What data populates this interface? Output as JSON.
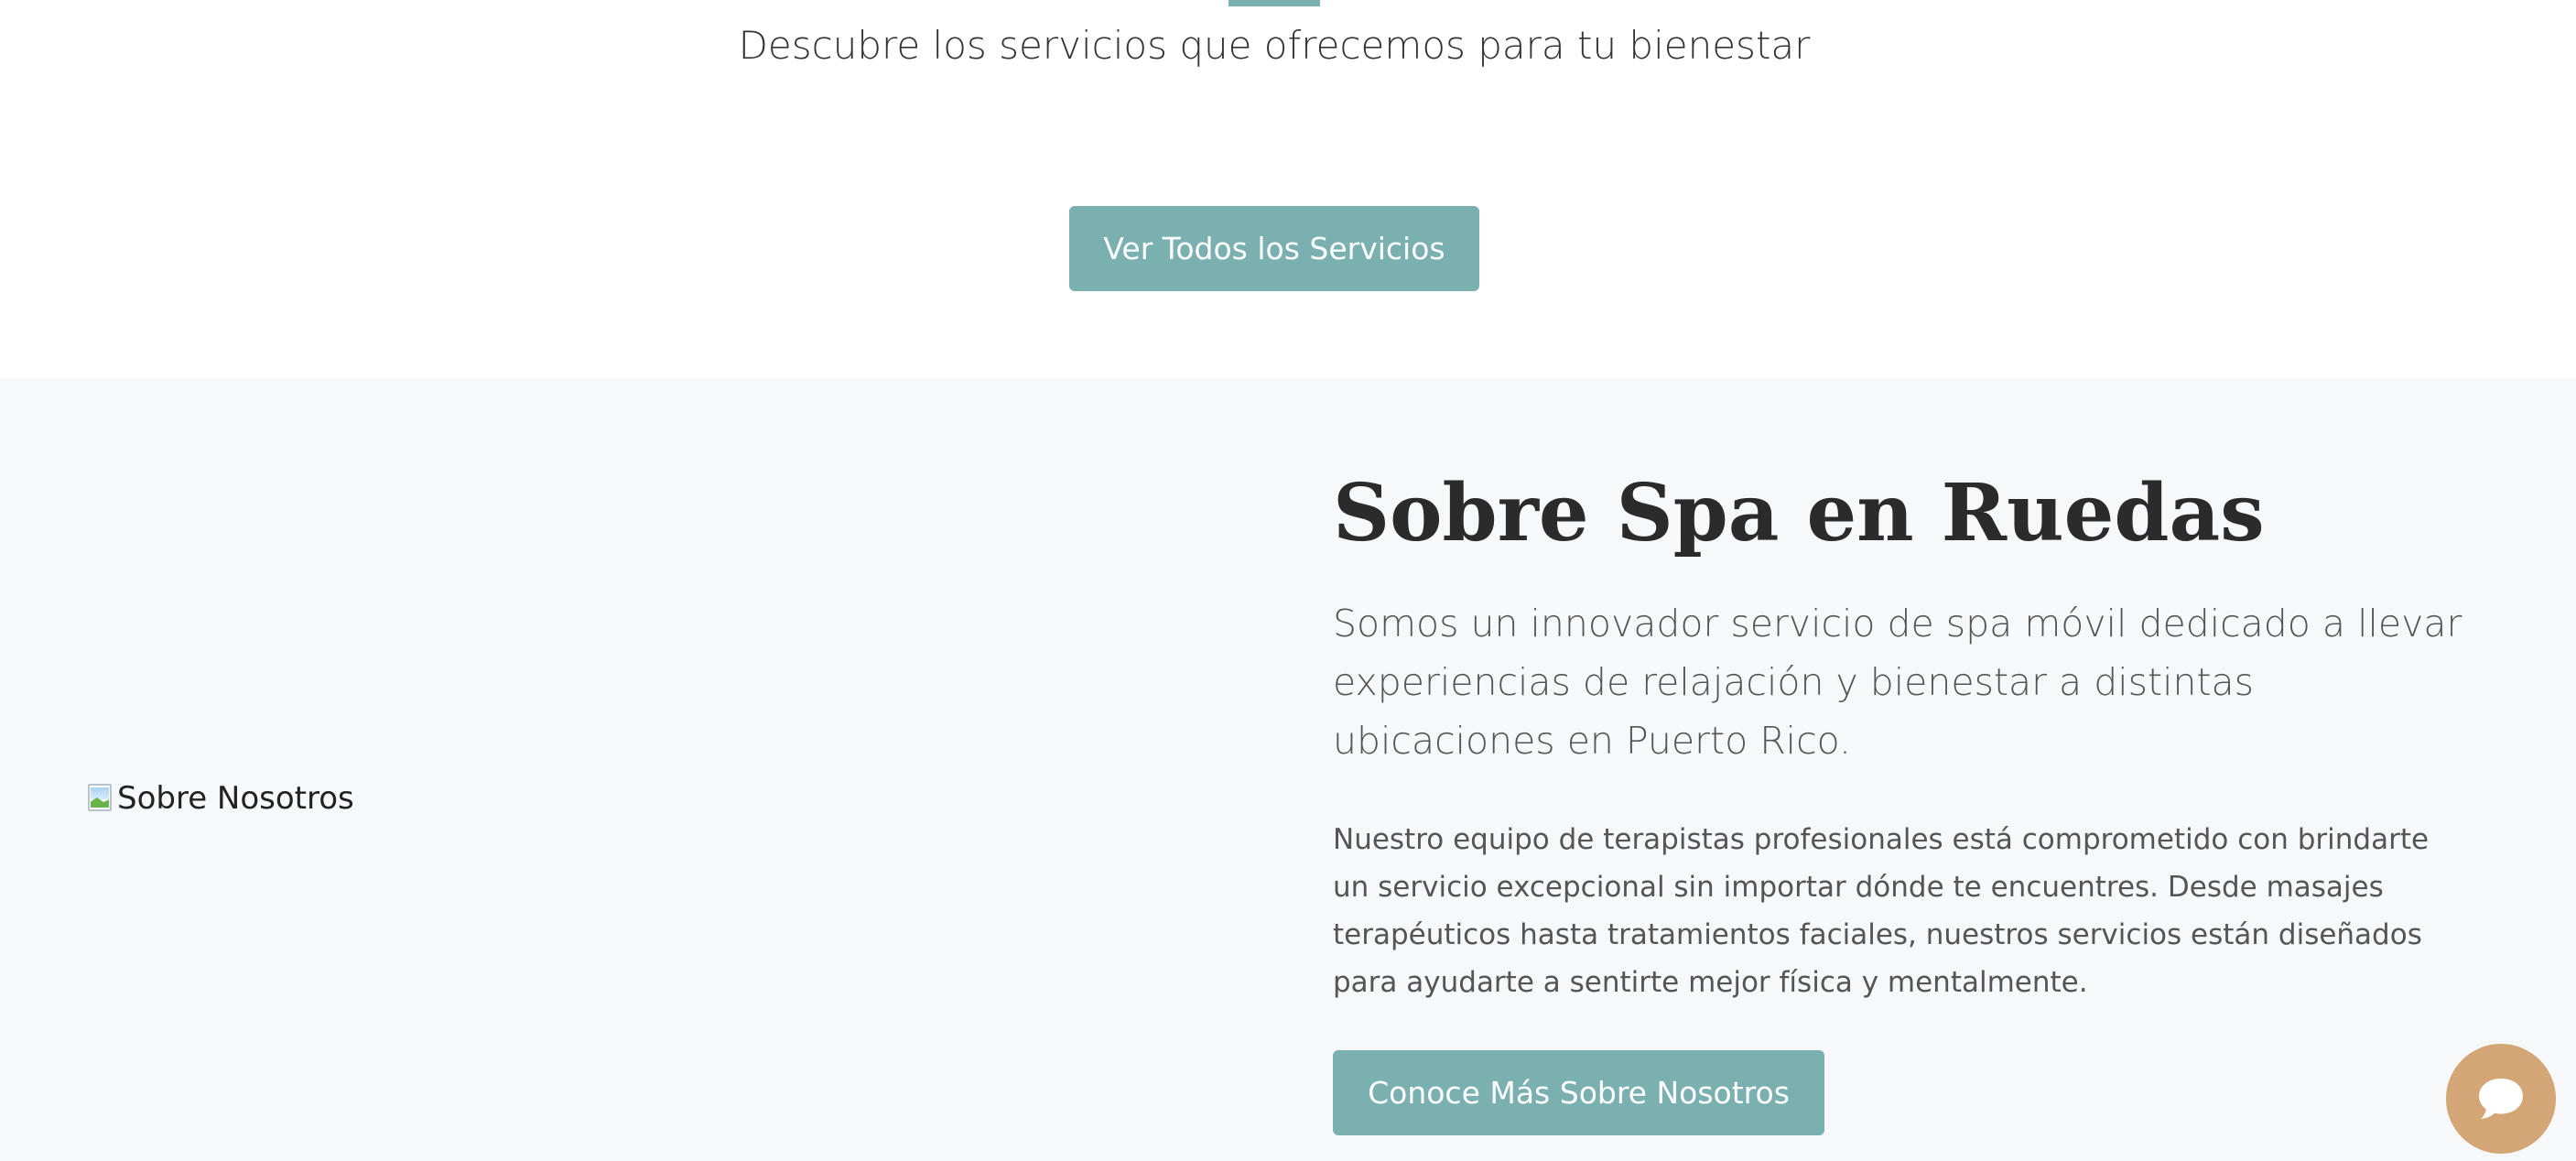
{
  "services": {
    "subtitle": "Descubre los servicios que ofrecemos para tu bienestar",
    "view_all_button": "Ver Todos los Servicios"
  },
  "about": {
    "image_alt": "Sobre Nosotros",
    "title": "Sobre Spa en Ruedas",
    "lead": "Somos un innovador servicio de spa móvil dedicado a llevar experiencias de relajación y bienestar a distintas ubicaciones en Puerto Rico.",
    "body": "Nuestro equipo de terapistas profesionales está comprometido con brindarte un servicio excepcional sin importar dónde te encuentres. Desde masajes terapéuticos hasta tratamientos faciales, nuestros servicios están diseñados para ayudarte a sentirte mejor física y mentalmente.",
    "cta_button": "Conoce Más Sobre Nosotros"
  },
  "chat": {
    "icon": "chat-bubble-icon"
  },
  "colors": {
    "accent": "#7ab1b0",
    "section_bg": "#f7f8f9",
    "chat": "#d4a676"
  }
}
